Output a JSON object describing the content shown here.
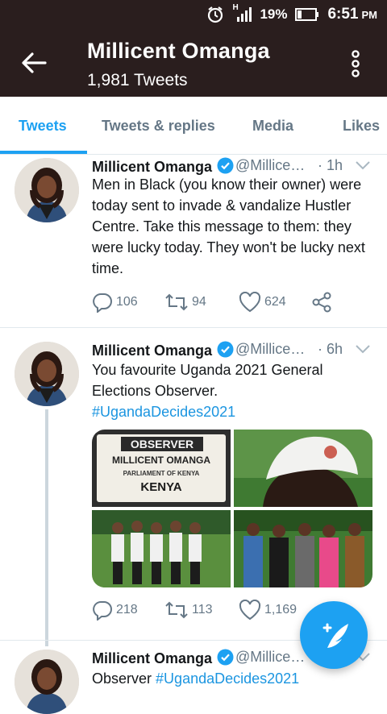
{
  "status": {
    "time": "6:51",
    "ampm": "PM",
    "battery": "19%",
    "network": "H"
  },
  "header": {
    "title": "Millicent Omanga",
    "subtitle": "1,981 Tweets"
  },
  "tabs": [
    {
      "label": "Tweets",
      "active": true
    },
    {
      "label": "Tweets & replies",
      "active": false
    },
    {
      "label": "Media",
      "active": false
    },
    {
      "label": "Likes",
      "active": false
    }
  ],
  "tweets": [
    {
      "name": "Millicent Omanga",
      "handle": "@Millice…",
      "time": "· 1h",
      "text": "Men in Black (you know their owner) were today sent to invade & vandalize Hustler Centre. Take this message to them: they were lucky today. They won't be lucky next time.",
      "replies": "106",
      "retweets": "94",
      "likes": "624"
    },
    {
      "name": "Millicent Omanga",
      "handle": "@Millice…",
      "time": "· 6h",
      "text": "You favourite Uganda 2021 General Elections Observer.",
      "hashtag": "#UgandaDecides2021",
      "media": {
        "badge_title": "OBSERVER",
        "badge_name": "MILLICENT OMANGA",
        "badge_org": "PARLIAMENT OF KENYA",
        "badge_country": "KENYA"
      },
      "replies": "218",
      "retweets": "113",
      "likes": "1,169"
    },
    {
      "name": "Millicent Omanga",
      "handle": "@Millice…",
      "text_prefix": "Observer",
      "hashtag": "#UgandaDecides2021"
    }
  ],
  "colors": {
    "accent": "#1da1f2",
    "header_bg": "#2a1e1e",
    "muted": "#657786"
  }
}
